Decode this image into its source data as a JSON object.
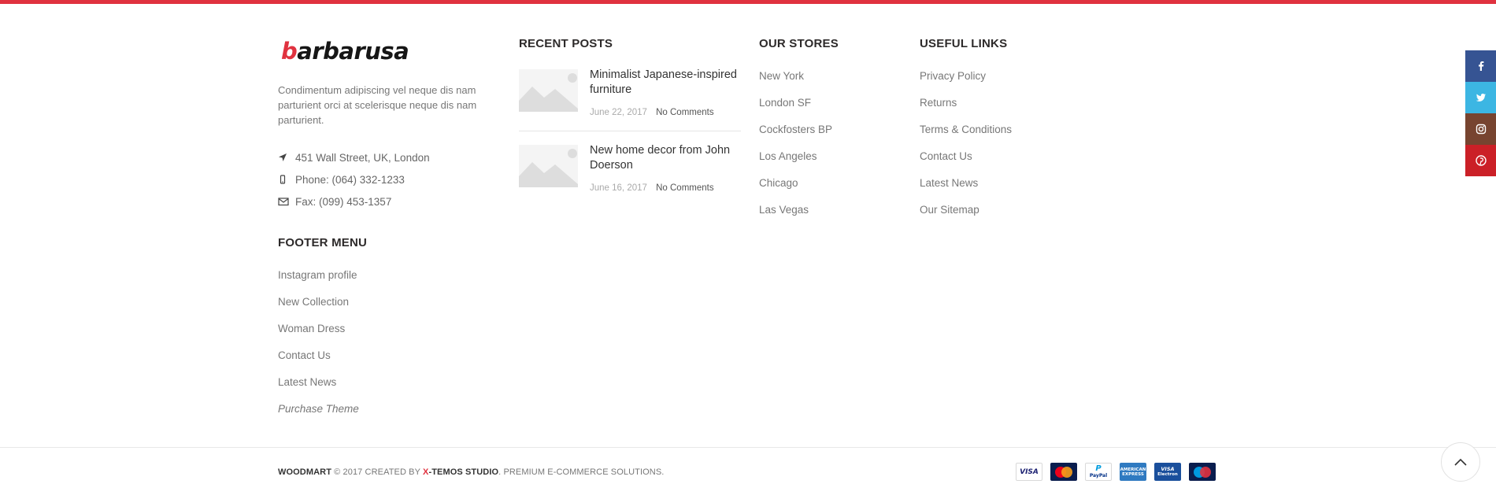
{
  "brand": {
    "logo_text": "barbarusa",
    "accent_color": "#e0323f"
  },
  "about": {
    "description": "Condimentum adipiscing vel neque dis nam parturient orci at scelerisque neque dis nam parturient.",
    "address": "451 Wall Street, UK, London",
    "phone": "Phone: (064) 332-1233",
    "fax": "Fax: (099) 453-1357"
  },
  "footer_menu": {
    "title": "FOOTER MENU",
    "items": [
      "Instagram profile",
      "New Collection",
      "Woman Dress",
      "Contact Us",
      "Latest News",
      "Purchase Theme"
    ]
  },
  "recent_posts": {
    "title": "RECENT POSTS",
    "posts": [
      {
        "title": "Minimalist Japanese-inspired furniture",
        "date": "June 22, 2017",
        "comments": "No Comments"
      },
      {
        "title": "New home decor from John Doerson",
        "date": "June 16, 2017",
        "comments": "No Comments"
      }
    ]
  },
  "our_stores": {
    "title": "OUR STORES",
    "items": [
      "New York",
      "London SF",
      "Cockfosters BP",
      "Los Angeles",
      "Chicago",
      "Las Vegas"
    ]
  },
  "useful_links": {
    "title": "USEFUL LINKS",
    "items": [
      "Privacy Policy",
      "Returns",
      "Terms & Conditions",
      "Contact Us",
      "Latest News",
      "Our Sitemap"
    ]
  },
  "copyright": {
    "brand": "WOODMART",
    "mid": " © 2017 CREATED BY ",
    "studio_x": "X",
    "studio_rest": "-TEMOS STUDIO",
    "tail": ". PREMIUM E-COMMERCE SOLUTIONS."
  },
  "payments": {
    "visa": "VISA",
    "paypal_top": "P",
    "paypal_bottom": "PayPal",
    "amex_top": "AMERICAN",
    "amex_bottom": "EXPRESS",
    "visa_electron_top": "VISA",
    "visa_electron_bottom": "Electron"
  },
  "social": {
    "icons": [
      "facebook-icon",
      "twitter-icon",
      "instagram-icon",
      "pinterest-icon"
    ],
    "colors": {
      "facebook": "#365493",
      "twitter": "#3cb6e3",
      "instagram": "#774430",
      "pinterest": "#cb2027"
    }
  },
  "scroll_top": {
    "icon": "chevron-up-icon"
  }
}
